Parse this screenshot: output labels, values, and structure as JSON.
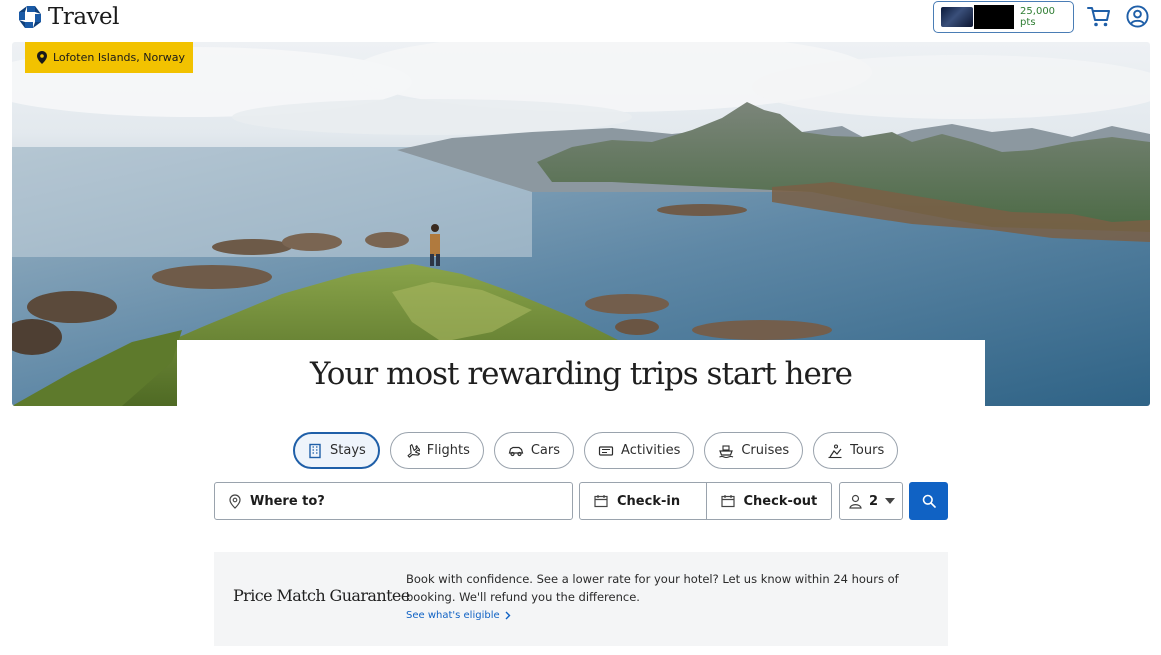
{
  "header": {
    "brand": "Travel",
    "points": "25,000 pts"
  },
  "hero": {
    "location": "Lofoten Islands, Norway",
    "headline": "Your most rewarding trips start here"
  },
  "tabs": [
    {
      "label": "Stays",
      "icon": "hotel-icon",
      "active": true
    },
    {
      "label": "Flights",
      "icon": "plane-icon",
      "active": false
    },
    {
      "label": "Cars",
      "icon": "car-icon",
      "active": false
    },
    {
      "label": "Activities",
      "icon": "ticket-icon",
      "active": false
    },
    {
      "label": "Cruises",
      "icon": "ship-icon",
      "active": false
    },
    {
      "label": "Tours",
      "icon": "tour-icon",
      "active": false
    }
  ],
  "search": {
    "where_placeholder": "Where to?",
    "checkin_label": "Check-in",
    "checkout_label": "Check-out",
    "guests": "2"
  },
  "price_match": {
    "title": "Price Match Guarantee",
    "body": "Book with confidence. See a lower rate for your hotel? Let us know within 24 hours of booking. We'll refund you the difference.",
    "link": "See what's eligible"
  },
  "colors": {
    "accent": "#1062c4",
    "badge": "#f2c200",
    "points": "#2e7d32"
  }
}
